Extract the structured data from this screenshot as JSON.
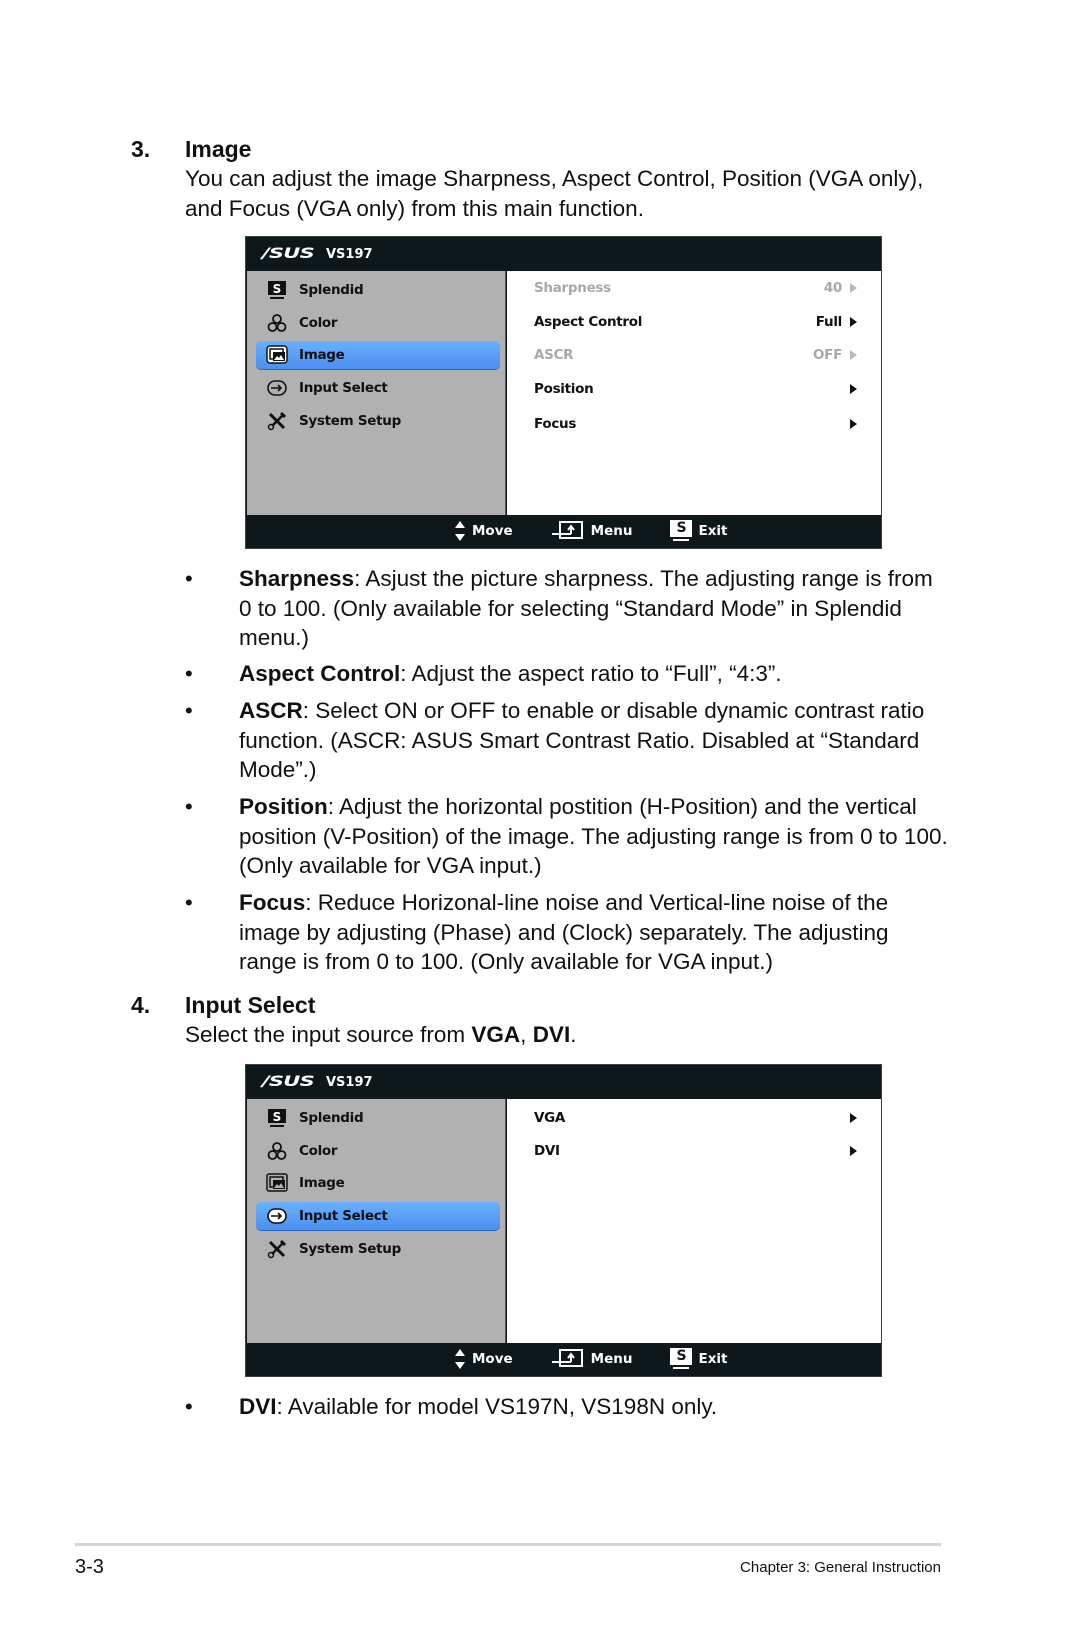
{
  "section3": {
    "number": "3.",
    "title": "Image",
    "description": "You can adjust the image Sharpness, Aspect Control, Position (VGA only), and Focus (VGA only) from this main function."
  },
  "osd1": {
    "brand": "/SUS",
    "model": "VS197",
    "menu": [
      {
        "label": "Splendid",
        "icon": "splendid-s-icon",
        "active": false
      },
      {
        "label": "Color",
        "icon": "color-rgb-icon",
        "active": false
      },
      {
        "label": "Image",
        "icon": "image-icon",
        "active": true
      },
      {
        "label": "Input Select",
        "icon": "input-select-icon",
        "active": false
      },
      {
        "label": "System Setup",
        "icon": "tools-icon",
        "active": false
      }
    ],
    "submenu": [
      {
        "label": "Sharpness",
        "value": "40",
        "disabled": true
      },
      {
        "label": "Aspect Control",
        "value": "Full",
        "disabled": false
      },
      {
        "label": "ASCR",
        "value": "OFF",
        "disabled": true
      },
      {
        "label": "Position",
        "value": "",
        "disabled": false
      },
      {
        "label": "Focus",
        "value": "",
        "disabled": false
      }
    ],
    "footer": {
      "move": "Move",
      "menu": "Menu",
      "exit": "Exit",
      "exit_key": "S"
    }
  },
  "bullets3": [
    {
      "term": "Sharpness",
      "text": ": Asjust the picture sharpness. The adjusting range is from 0 to 100. (Only available for selecting “Standard Mode” in Splendid menu.)"
    },
    {
      "term": "Aspect Control",
      "text": ": Adjust the aspect ratio to “Full”, “4:3”."
    },
    {
      "term": "ASCR",
      "text": ": Select ON or OFF to enable or disable dynamic contrast ratio function. (ASCR: ASUS Smart Contrast Ratio. Disabled at “Standard Mode”.)"
    },
    {
      "term": "Position",
      "text": ": Adjust the horizontal postition (H-Position) and the vertical position (V-Position) of the image. The adjusting range is from 0 to 100. (Only available for VGA input.)"
    },
    {
      "term": "Focus",
      "text": ": Reduce Horizonal-line noise and Vertical-line noise of the image by adjusting (Phase) and (Clock) separately. The adjusting range is from 0 to 100. (Only available for VGA input.)"
    }
  ],
  "section4": {
    "number": "4.",
    "title": "Input Select",
    "desc_prefix": "Select the input source from ",
    "desc_bold1": "VGA",
    "desc_sep": ", ",
    "desc_bold2": "DVI",
    "desc_suffix": "."
  },
  "osd2": {
    "brand": "/SUS",
    "model": "VS197",
    "menu": [
      {
        "label": "Splendid",
        "active": false
      },
      {
        "label": "Color",
        "active": false
      },
      {
        "label": "Image",
        "active": false
      },
      {
        "label": "Input Select",
        "active": true
      },
      {
        "label": "System Setup",
        "active": false
      }
    ],
    "submenu": [
      {
        "label": "VGA"
      },
      {
        "label": "DVI"
      }
    ],
    "footer": {
      "move": "Move",
      "menu": "Menu",
      "exit": "Exit",
      "exit_key": "S"
    }
  },
  "bullets4": [
    {
      "term": "DVI",
      "text": ": Available for model VS197N, VS198N only."
    }
  ],
  "bullet_char": "•",
  "page_footer": {
    "page_number": "3-3",
    "chapter": "Chapter 3: General Instruction"
  }
}
